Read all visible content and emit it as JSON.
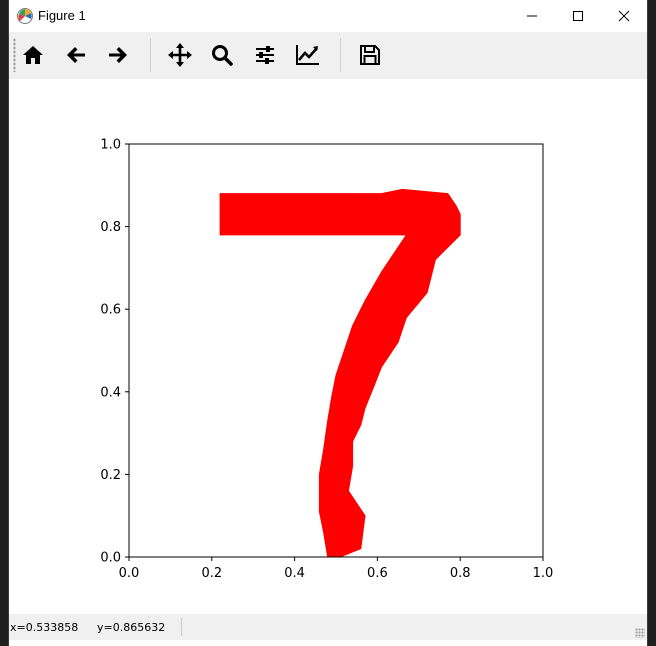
{
  "window": {
    "title": "Figure 1"
  },
  "toolbar": {
    "buttons": [
      {
        "name": "home",
        "icon": "home-icon"
      },
      {
        "name": "back",
        "icon": "arrow-left-icon"
      },
      {
        "name": "forward",
        "icon": "arrow-right-icon"
      },
      {
        "name": "pan",
        "icon": "move-icon"
      },
      {
        "name": "zoom",
        "icon": "zoom-icon"
      },
      {
        "name": "subplots",
        "icon": "sliders-icon"
      },
      {
        "name": "edit-axes",
        "icon": "line-chart-icon"
      },
      {
        "name": "save",
        "icon": "floppy-disk-icon"
      }
    ]
  },
  "status": {
    "x_readout": "x=0.533858",
    "y_readout": "y=0.865632"
  },
  "chart_data": {
    "type": "area",
    "title": "",
    "xlabel": "",
    "ylabel": "",
    "xlim": [
      0.0,
      1.0
    ],
    "ylim": [
      0.0,
      1.0
    ],
    "xticks": [
      "0.0",
      "0.2",
      "0.4",
      "0.6",
      "0.8",
      "1.0"
    ],
    "yticks": [
      "0.0",
      "0.2",
      "0.4",
      "0.6",
      "0.8",
      "1.0"
    ],
    "grid": false,
    "series": [
      {
        "color": "#ff0000",
        "fill": true,
        "shape": "digit-seven",
        "polygon_x": [
          0.22,
          0.32,
          0.35,
          0.61,
          0.66,
          0.77,
          0.79,
          0.8,
          0.8,
          0.74,
          0.72,
          0.67,
          0.65,
          0.61,
          0.59,
          0.57,
          0.56,
          0.54,
          0.54,
          0.53,
          0.57,
          0.56,
          0.51,
          0.48,
          0.47,
          0.46,
          0.46,
          0.47,
          0.48,
          0.49,
          0.5,
          0.52,
          0.54,
          0.57,
          0.61,
          0.65,
          0.67,
          0.67,
          0.64,
          0.59,
          0.53,
          0.42,
          0.35,
          0.32,
          0.22
        ],
        "polygon_y": [
          0.88,
          0.88,
          0.88,
          0.88,
          0.89,
          0.88,
          0.85,
          0.83,
          0.78,
          0.72,
          0.64,
          0.58,
          0.52,
          0.46,
          0.41,
          0.36,
          0.32,
          0.28,
          0.22,
          0.16,
          0.1,
          0.02,
          0.0,
          0.0,
          0.06,
          0.11,
          0.2,
          0.26,
          0.33,
          0.39,
          0.44,
          0.5,
          0.56,
          0.62,
          0.69,
          0.75,
          0.78,
          0.78,
          0.78,
          0.78,
          0.78,
          0.78,
          0.78,
          0.78,
          0.78
        ]
      }
    ]
  }
}
